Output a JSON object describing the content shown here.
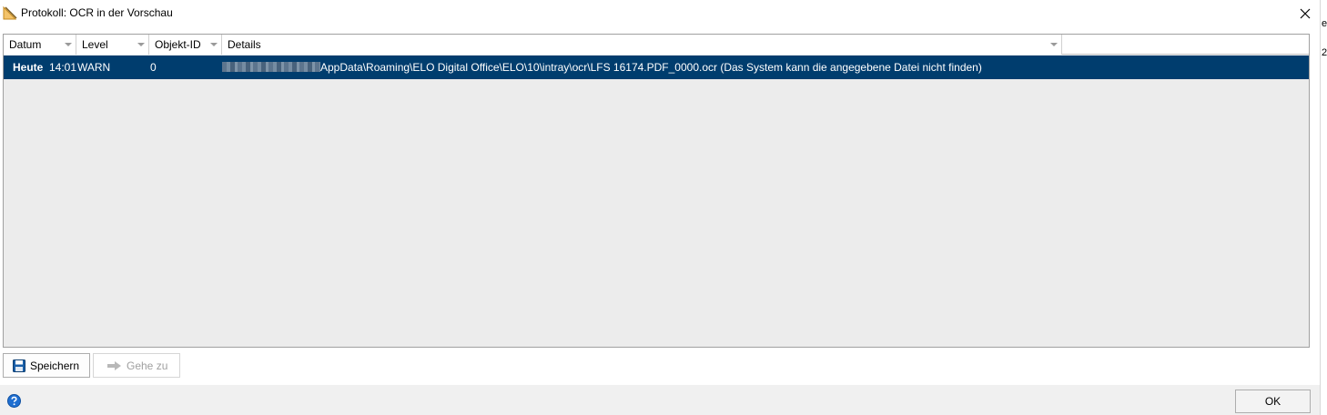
{
  "window": {
    "title": "Protokoll: OCR in der Vorschau"
  },
  "grid": {
    "columns": [
      {
        "label": "Datum"
      },
      {
        "label": "Level"
      },
      {
        "label": "Objekt-ID"
      },
      {
        "label": "Details"
      }
    ],
    "rows": [
      {
        "date_day": "Heute",
        "date_time": "14:01",
        "level": "WARN",
        "object_id": "0",
        "details": "AppData\\Roaming\\ELO Digital Office\\ELO\\10\\intray\\ocr\\LFS 16174.PDF_0000.ocr (Das System kann die angegebene Datei nicht finden)",
        "selected": true
      }
    ],
    "selection_color": "#003d6e"
  },
  "toolbar": {
    "save_label": "Speichern",
    "goto_label": "Gehe zu"
  },
  "footer": {
    "ok_label": "OK"
  },
  "right_strip": {
    "chars": [
      "e",
      "2"
    ]
  },
  "icons": {
    "app": "elo-app-icon",
    "close": "close-icon",
    "save": "floppy-disk-icon",
    "goto": "arrow-right-icon",
    "help": "help-icon"
  }
}
